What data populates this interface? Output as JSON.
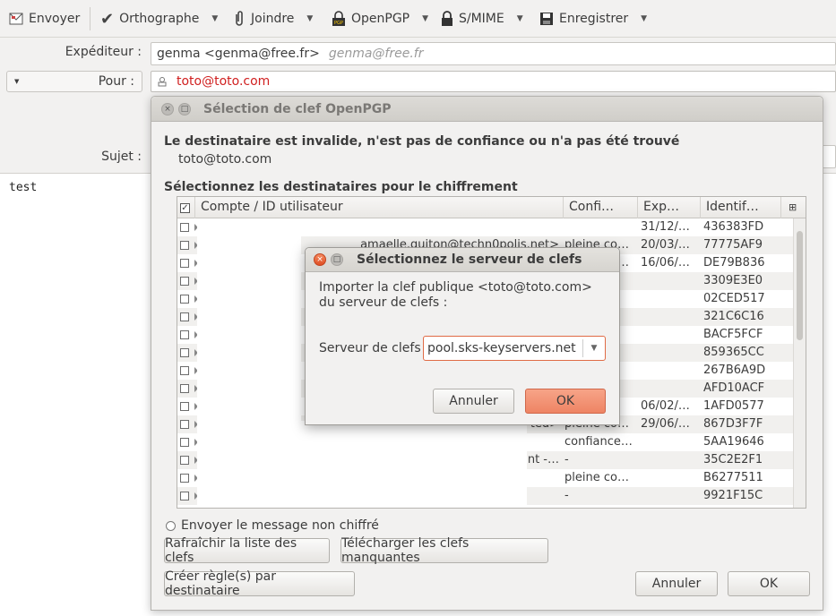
{
  "toolbar": {
    "send": "Envoyer",
    "spelling": "Orthographe",
    "attach": "Joindre",
    "openpgp": "OpenPGP",
    "smime": "S/MIME",
    "save": "Enregistrer"
  },
  "header": {
    "from_label": "Expéditeur :",
    "from_value": "genma <genma@free.fr>",
    "from_hint": "genma@free.fr",
    "to_label": "Pour :",
    "to_value": "toto@toto.com",
    "subject_label": "Sujet :"
  },
  "body_text": "test",
  "key_dialog": {
    "title": "Sélection de clef OpenPGP",
    "invalid_msg": "Le destinataire est invalide, n'est pas de confiance ou n'a pas été trouvé",
    "invalid_recipient": "toto@toto.com",
    "select_msg": "Sélectionnez les destinataires pour le chiffrement",
    "columns": [
      "Compte / ID utilisateur",
      "Confi…",
      "Exp…",
      "Identif…"
    ],
    "rows": [
      {
        "account": "",
        "trust": "",
        "exp": "31/12/…",
        "id": "436383FD"
      },
      {
        "account": "amaelle.guiton@techn0polis.net>",
        "trust": "pleine co…",
        "exp": "20/03/…",
        "id": "77775AF9"
      },
      {
        "account": "",
        "trust": "pleine co…",
        "exp": "16/06/…",
        "id": "DE79B836"
      },
      {
        "account": "",
        "trust": "-",
        "exp": "",
        "id": "3309E3E0"
      },
      {
        "account": "",
        "trust": "",
        "exp": "",
        "id": "02CED517"
      },
      {
        "account": "",
        "trust": "",
        "exp": "",
        "id": "321C6C16"
      },
      {
        "account": "",
        "trust": "",
        "exp": "",
        "id": "BACF5FCF"
      },
      {
        "account": "",
        "trust": "",
        "exp": "",
        "id": "859365CC"
      },
      {
        "account": "",
        "trust": "",
        "exp": "",
        "id": "267B6A9D"
      },
      {
        "account": "",
        "trust": "",
        "exp": "",
        "id": "AFD10ACF"
      },
      {
        "account": "",
        "trust": "",
        "exp": "06/02/…",
        "id": "1AFD0577"
      },
      {
        "account": "ted>",
        "trust": "pleine co…",
        "exp": "29/06/…",
        "id": "867D3F7F"
      },
      {
        "account": "",
        "trust": "confiance…",
        "exp": "",
        "id": "5AA19646"
      },
      {
        "account": "nt -…",
        "trust": "-",
        "exp": "",
        "id": "35C2E2F1"
      },
      {
        "account": "",
        "trust": "pleine co…",
        "exp": "",
        "id": "B6277511"
      },
      {
        "account": "",
        "trust": "-",
        "exp": "",
        "id": "9921F15C"
      }
    ],
    "send_unencrypted": "Envoyer le message non chiffré",
    "refresh_btn": "Rafraîchir la liste des clefs",
    "download_btn": "Télécharger les clefs manquantes",
    "rules_btn": "Créer règle(s) par destinataire",
    "cancel_btn": "Annuler",
    "ok_btn": "OK"
  },
  "server_dialog": {
    "title": "Sélectionnez le serveur de clefs",
    "message": "Importer la clef publique <toto@toto.com> du serveur de clefs :",
    "server_label": "Serveur de clefs",
    "server_value": "pool.sks-keyservers.net",
    "cancel_btn": "Annuler",
    "ok_btn": "OK"
  },
  "colors": {
    "recipient_red": "#d01f1f",
    "ok_orange": "#ee8464"
  }
}
